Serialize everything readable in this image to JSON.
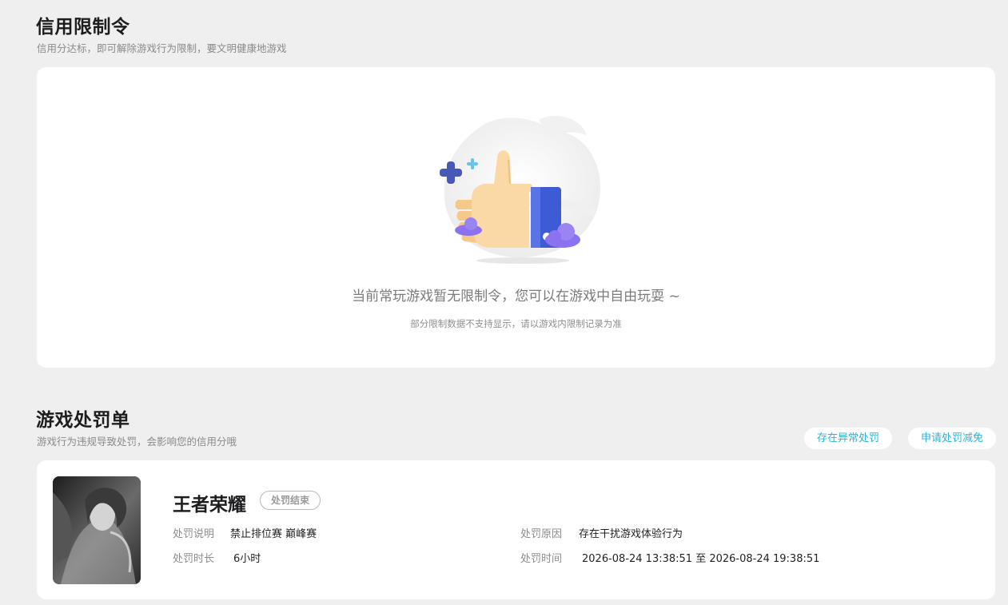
{
  "credit": {
    "title": "信用限制令",
    "subtitle": "信用分达标，即可解除游戏行为限制，要文明健康地游戏",
    "empty_message": "当前常玩游戏暂无限制令，您可以在游戏中自由玩耍 ~",
    "empty_note": "部分限制数据不支持显示，请以游戏内限制记录为准"
  },
  "punish": {
    "title": "游戏处罚单",
    "subtitle": "游戏行为违规导致处罚，会影响您的信用分哦",
    "buttons": {
      "abnormal": "存在异常处罚",
      "reduce": "申请处罚减免"
    },
    "record": {
      "game_name": "王者荣耀",
      "status": "处罚结束",
      "desc_label": "处罚说明",
      "desc_value": "禁止排位赛 巅峰赛",
      "reason_label": "处罚原因",
      "reason_value": "存在干扰游戏体验行为",
      "duration_label": "处罚时长",
      "duration_value": "6小时",
      "time_label": "处罚时间",
      "time_value": "2026-08-24 13:38:51 至 2026-08-24 19:38:51"
    }
  },
  "colors": {
    "accent": "#2bb3d6",
    "page_bg": "#efefef",
    "card_bg": "#ffffff",
    "thumb": "#fbd9a6",
    "cuff": "#3e5bd6",
    "cloud": "#8b72f0"
  }
}
